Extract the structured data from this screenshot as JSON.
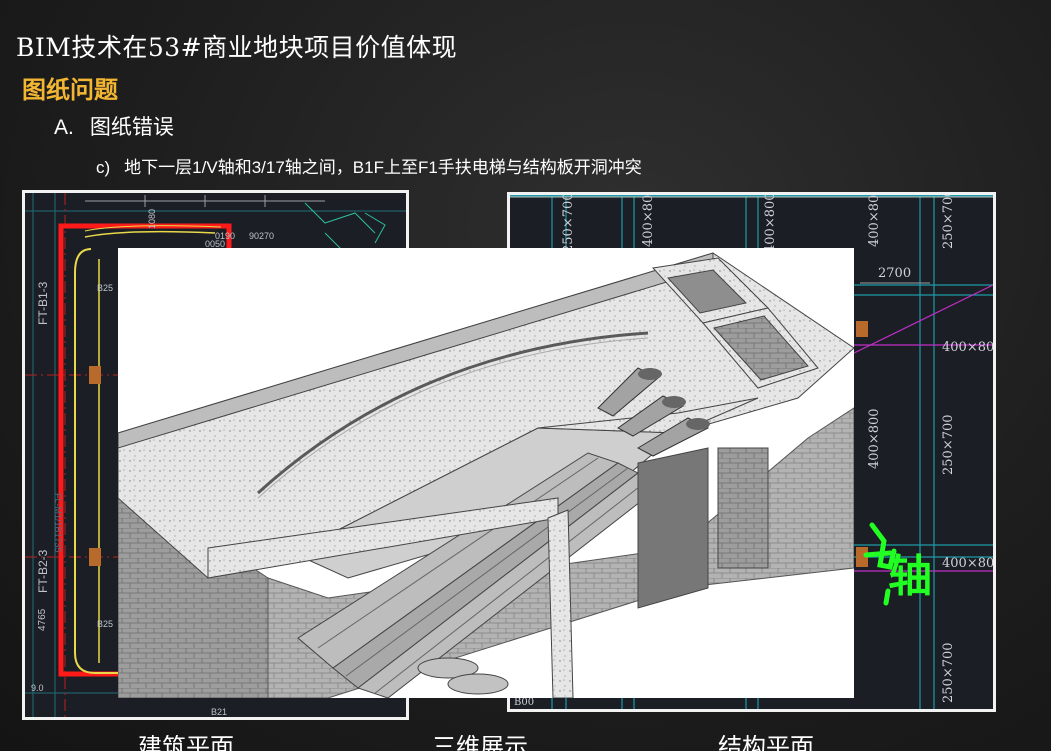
{
  "slide": {
    "title": "BIM技术在53#商业地块项目价值体现",
    "subtitle": "图纸问题",
    "level1": {
      "marker": "A.",
      "text": "图纸错误"
    },
    "level2": {
      "marker": "c)",
      "text": "地下一层1/V轴和3/17轴之间，B1F上至F1手扶电梯与结构板开洞冲突"
    }
  },
  "left_drawing": {
    "labels": [
      "FT-B1-3",
      "FT-B2-3",
      "4765",
      "B25",
      "B25",
      "FL-M1/1B1735",
      "0050",
      "B21",
      "1080",
      "90270",
      "0190",
      "9.0"
    ]
  },
  "right_drawing": {
    "dims": [
      "250×700",
      "400×800",
      "400×800",
      "400×800",
      "250×700",
      "2700",
      "400×80",
      "400×800",
      "250×700",
      "400×80",
      "250×700",
      "B00"
    ],
    "handwriting": "轴"
  },
  "captions": {
    "left": "建筑平面",
    "center": "三维展示",
    "right": "结构平面"
  },
  "colors": {
    "title": "#ffffff",
    "subtitle": "#f2b632",
    "background": "#1e1e1e"
  }
}
